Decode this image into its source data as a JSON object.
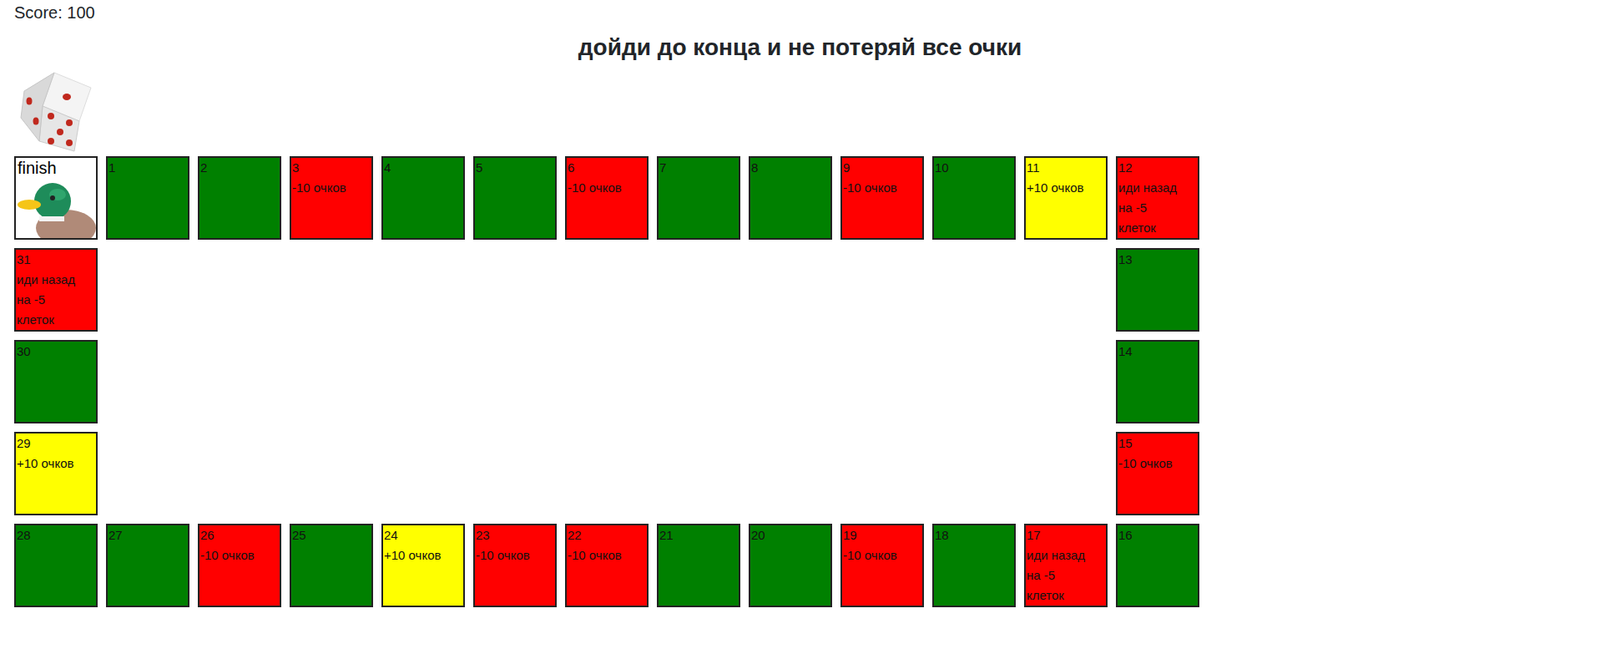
{
  "score": "Score: 100",
  "title": "дойди до конца и не потеряй все очки",
  "finish": {
    "label": "finish"
  },
  "cells": [
    {
      "number": "1",
      "text": "",
      "kind": "plain",
      "color": "#008000"
    },
    {
      "number": "2",
      "text": "",
      "kind": "plain",
      "color": "#008000"
    },
    {
      "number": "3",
      "text": "-10 очков",
      "kind": "penalty",
      "color": "#ff0000"
    },
    {
      "number": "4",
      "text": "",
      "kind": "plain",
      "color": "#008000"
    },
    {
      "number": "5",
      "text": "",
      "kind": "plain",
      "color": "#008000"
    },
    {
      "number": "6",
      "text": "-10 очков",
      "kind": "penalty",
      "color": "#ff0000"
    },
    {
      "number": "7",
      "text": "",
      "kind": "plain",
      "color": "#008000"
    },
    {
      "number": "8",
      "text": "",
      "kind": "plain",
      "color": "#008000"
    },
    {
      "number": "9",
      "text": "-10 очков",
      "kind": "penalty",
      "color": "#ff0000"
    },
    {
      "number": "10",
      "text": "",
      "kind": "plain",
      "color": "#008000"
    },
    {
      "number": "11",
      "text": "+10 очков",
      "kind": "bonus",
      "color": "#ffff00"
    },
    {
      "number": "12",
      "text": "иди назад на -5 клеток",
      "kind": "back",
      "color": "#ff0000"
    },
    {
      "number": "13",
      "text": "",
      "kind": "plain",
      "color": "#008000"
    },
    {
      "number": "14",
      "text": "",
      "kind": "plain",
      "color": "#008000"
    },
    {
      "number": "15",
      "text": "-10 очков",
      "kind": "penalty",
      "color": "#ff0000"
    },
    {
      "number": "16",
      "text": "",
      "kind": "plain",
      "color": "#008000"
    },
    {
      "number": "17",
      "text": "иди назад на -5 клеток",
      "kind": "back",
      "color": "#ff0000"
    },
    {
      "number": "18",
      "text": "",
      "kind": "plain",
      "color": "#008000"
    },
    {
      "number": "19",
      "text": "-10 очков",
      "kind": "penalty",
      "color": "#ff0000"
    },
    {
      "number": "20",
      "text": "",
      "kind": "plain",
      "color": "#008000"
    },
    {
      "number": "21",
      "text": "",
      "kind": "plain",
      "color": "#008000"
    },
    {
      "number": "22",
      "text": "-10 очков",
      "kind": "penalty",
      "color": "#ff0000"
    },
    {
      "number": "23",
      "text": "-10 очков",
      "kind": "penalty",
      "color": "#ff0000"
    },
    {
      "number": "24",
      "text": "+10 очков",
      "kind": "bonus",
      "color": "#ffff00"
    },
    {
      "number": "25",
      "text": "",
      "kind": "plain",
      "color": "#008000"
    },
    {
      "number": "26",
      "text": "-10 очков",
      "kind": "penalty",
      "color": "#ff0000"
    },
    {
      "number": "27",
      "text": "",
      "kind": "plain",
      "color": "#008000"
    },
    {
      "number": "28",
      "text": "",
      "kind": "plain",
      "color": "#008000"
    },
    {
      "number": "29",
      "text": "+10 очков",
      "kind": "bonus",
      "color": "#ffff00"
    },
    {
      "number": "30",
      "text": "",
      "kind": "plain",
      "color": "#008000"
    },
    {
      "number": "31",
      "text": "иди назад на -5 клеток",
      "kind": "back",
      "color": "#ff0000"
    }
  ]
}
